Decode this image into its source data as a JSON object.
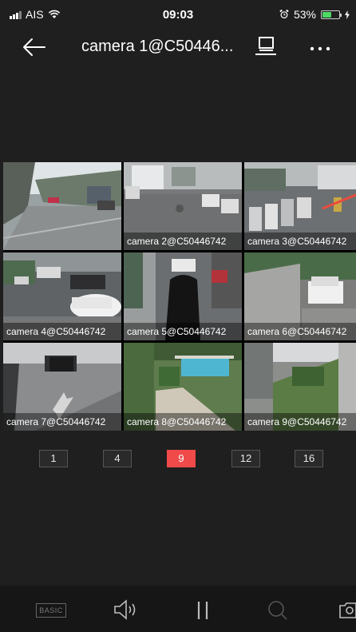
{
  "status_bar": {
    "carrier": "AIS",
    "time": "09:03",
    "battery": "53%",
    "battery_level": 0.53
  },
  "nav": {
    "title": "camera 1@C50446..."
  },
  "cameras": [
    {
      "label": ""
    },
    {
      "label": "camera 2@C50446742"
    },
    {
      "label": "camera 3@C50446742"
    },
    {
      "label": "camera 4@C50446742"
    },
    {
      "label": "camera 5@C50446742"
    },
    {
      "label": "camera 6@C50446742"
    },
    {
      "label": "camera 7@C50446742"
    },
    {
      "label": "camera 8@C50446742"
    },
    {
      "label": "camera 9@C50446742"
    }
  ],
  "layout_options": [
    "1",
    "4",
    "9",
    "12",
    "16"
  ],
  "active_layout": "9",
  "toolbar": {
    "basic_label": "BASIC"
  },
  "colors": {
    "accent": "#f04a4a",
    "selected_border": "#c0303a",
    "battery": "#4cd964"
  }
}
